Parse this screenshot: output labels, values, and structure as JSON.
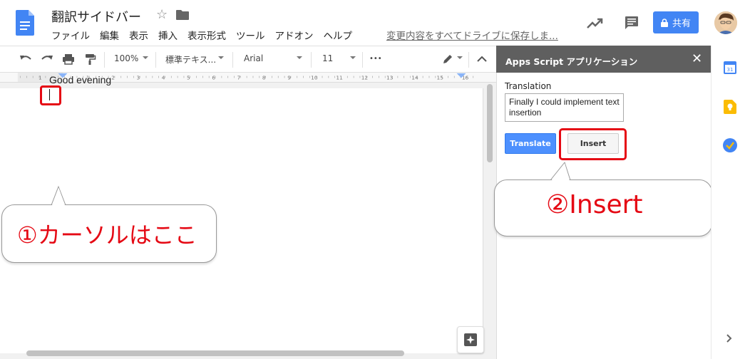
{
  "doc": {
    "title": "翻訳サイドバー",
    "menu": [
      "ファイル",
      "編集",
      "表示",
      "挿入",
      "表示形式",
      "ツール",
      "アドオン",
      "ヘルプ"
    ],
    "save_status": "変更内容をすべてドライブに保存しま...",
    "share_label": "共有"
  },
  "toolbar": {
    "zoom": "100%",
    "style": "標準テキス...",
    "font": "Arial",
    "font_size": "11",
    "more": "•••"
  },
  "ruler": {
    "numbers": [
      "1",
      "1",
      "2",
      "3",
      "4",
      "5",
      "6",
      "7",
      "8",
      "9",
      "10",
      "11",
      "12",
      "13",
      "14",
      "15",
      "16"
    ]
  },
  "document": {
    "text": "Good evening"
  },
  "sidebar": {
    "title": "Apps Script アプリケーション",
    "close": "✕",
    "translation_label": "Translation",
    "translation_value": "Finally I could implement text insertion",
    "translate_button": "Translate",
    "insert_button": "Insert"
  },
  "callouts": {
    "cursor_note": "①カーソルはここ",
    "insert_note": "②Insert"
  },
  "colors": {
    "accent_blue": "#4285f4",
    "highlight_red": "#e50914",
    "sidebar_header": "#5f5f5f"
  },
  "icons": [
    "docs-logo",
    "star-icon",
    "folder-icon",
    "trend-icon",
    "comment-icon",
    "lock-icon",
    "undo-icon",
    "redo-icon",
    "print-icon",
    "paint-format-icon",
    "pencil-icon",
    "collapse-icon",
    "explore-icon",
    "calendar-icon",
    "keep-icon",
    "tasks-icon",
    "chevron-right-icon"
  ],
  "rail": {
    "calendar_day": "31"
  }
}
